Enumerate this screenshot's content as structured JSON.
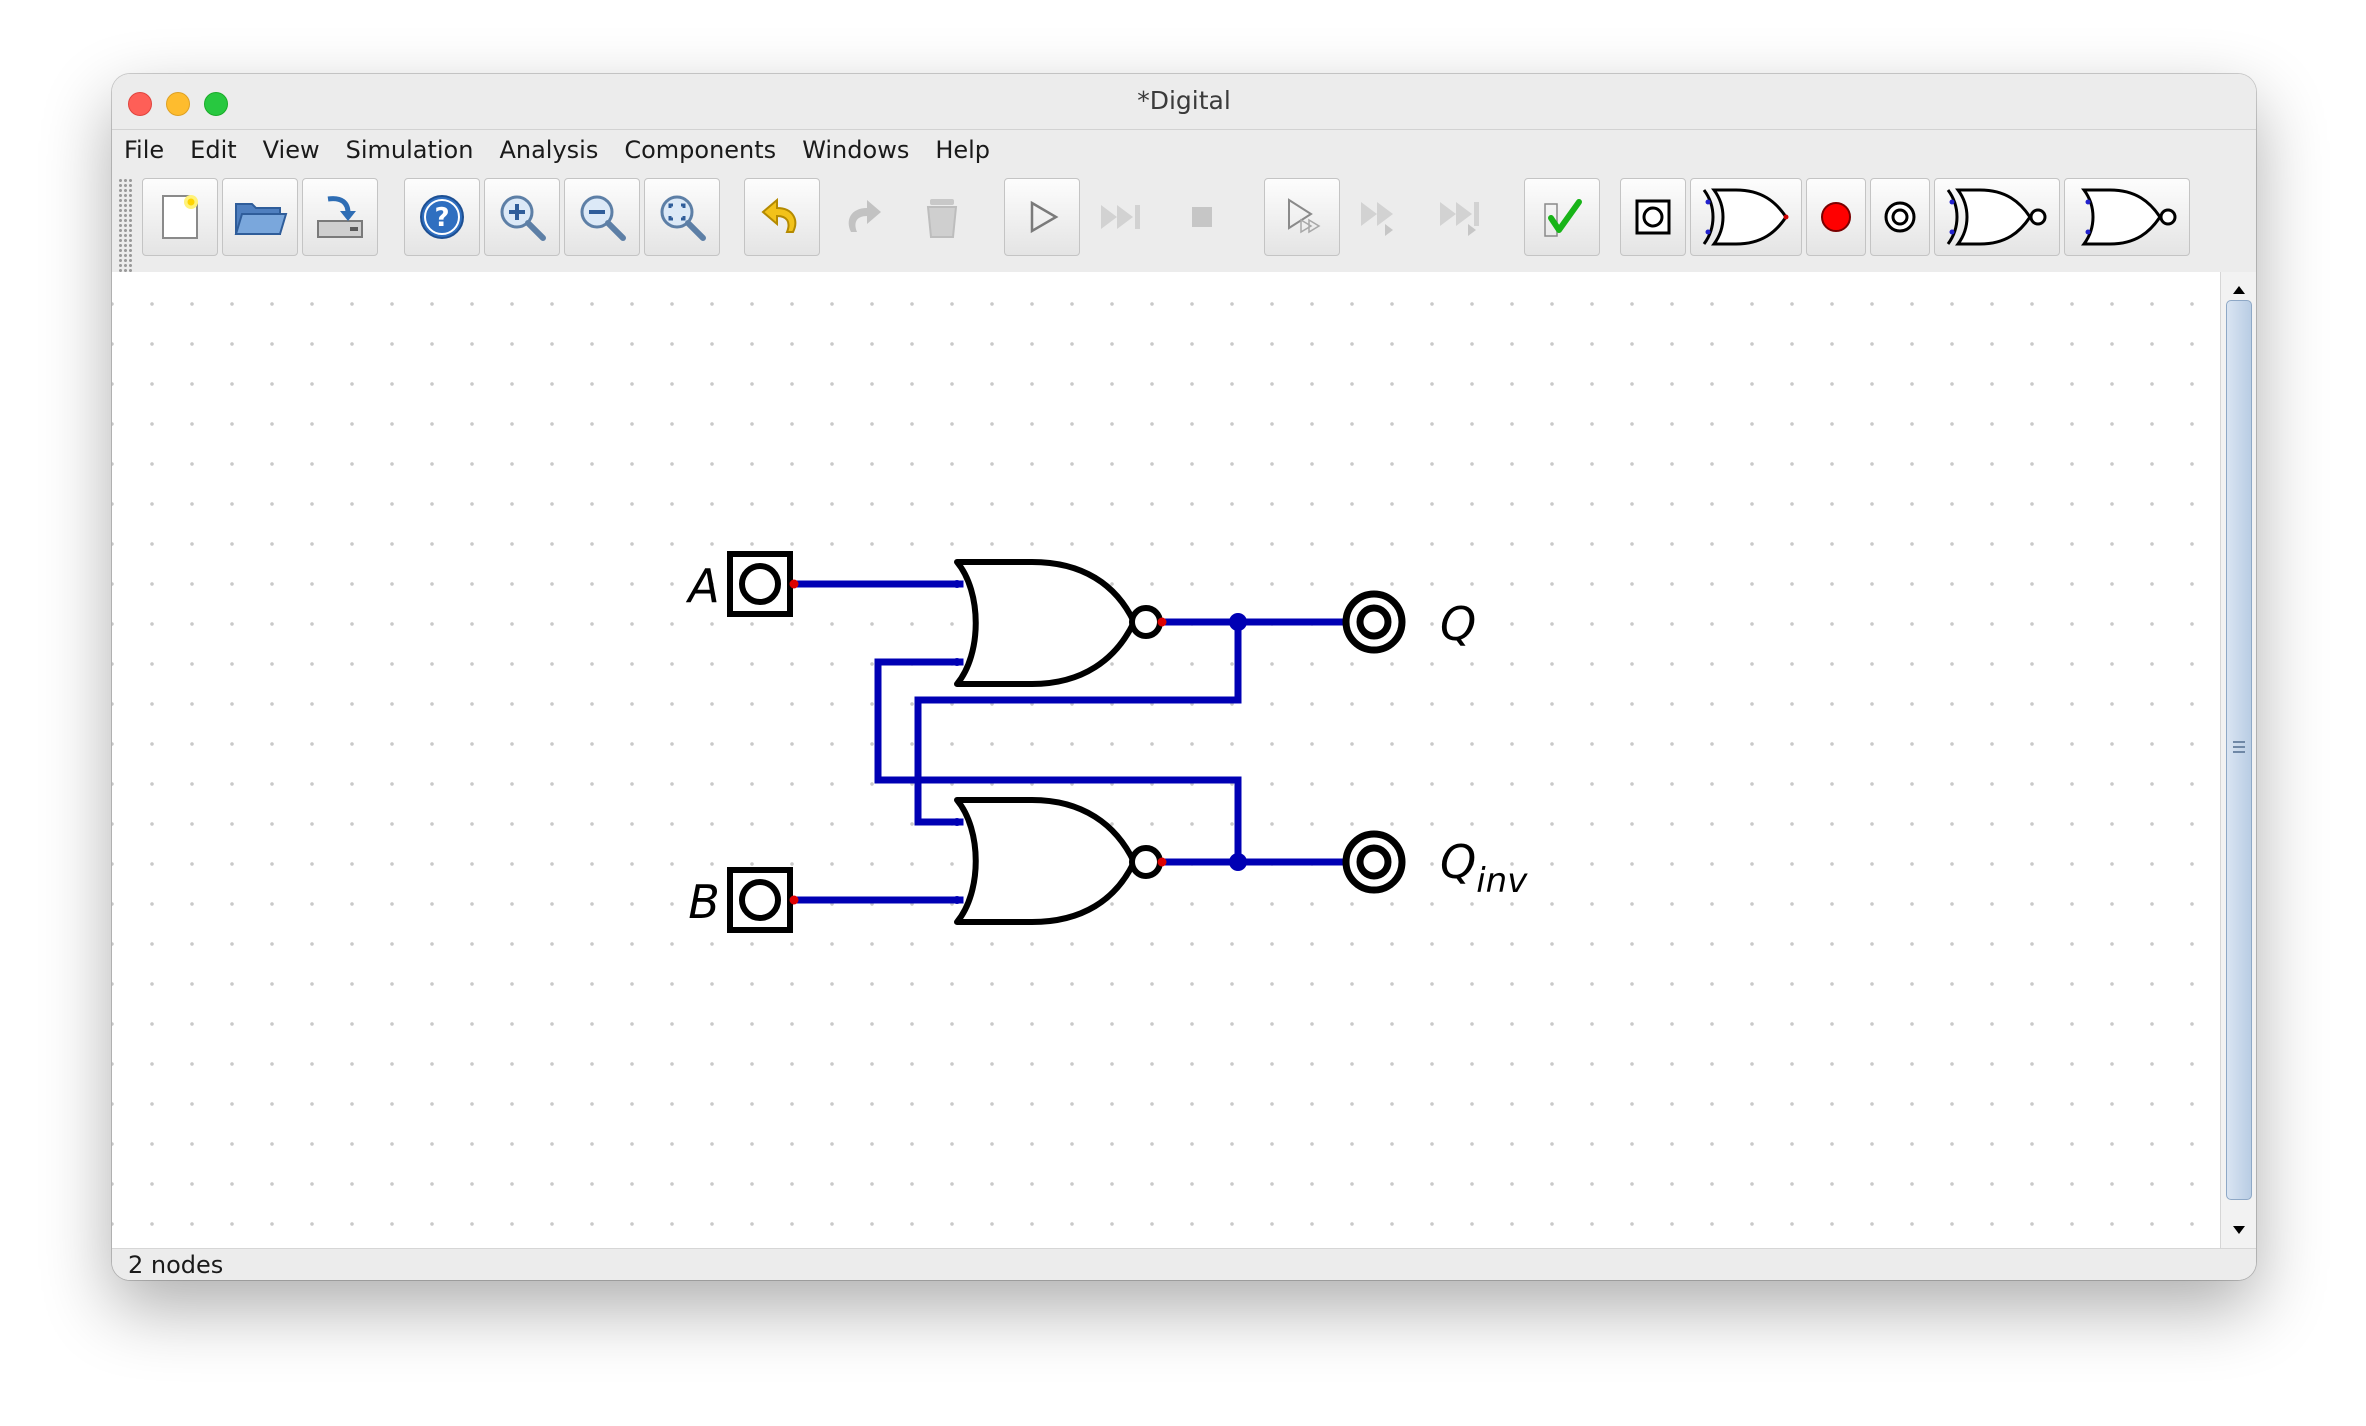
{
  "window": {
    "title": "*Digital"
  },
  "menu": {
    "items": [
      "File",
      "Edit",
      "View",
      "Simulation",
      "Analysis",
      "Components",
      "Windows",
      "Help"
    ]
  },
  "toolbar": {
    "buttons": [
      {
        "icon": "new-file-icon",
        "enabled": true
      },
      {
        "icon": "open-folder-icon",
        "enabled": true
      },
      {
        "icon": "save-icon",
        "enabled": true
      },
      {
        "icon": "help-icon",
        "enabled": true
      },
      {
        "icon": "zoom-in-icon",
        "enabled": true
      },
      {
        "icon": "zoom-out-icon",
        "enabled": true
      },
      {
        "icon": "zoom-fit-icon",
        "enabled": true
      },
      {
        "icon": "undo-icon",
        "enabled": true
      },
      {
        "icon": "redo-icon",
        "enabled": false
      },
      {
        "icon": "delete-icon",
        "enabled": false
      },
      {
        "icon": "play-icon",
        "enabled": true
      },
      {
        "icon": "fast-forward-icon",
        "enabled": false
      },
      {
        "icon": "stop-icon",
        "enabled": false
      },
      {
        "icon": "micro-step-icon",
        "enabled": true
      },
      {
        "icon": "step-icon",
        "enabled": false
      },
      {
        "icon": "run-to-break-icon",
        "enabled": false
      },
      {
        "icon": "test-check-icon",
        "enabled": true
      },
      {
        "icon": "input-component-icon",
        "enabled": true
      },
      {
        "icon": "xor-gate-icon",
        "enabled": true
      },
      {
        "icon": "led-icon",
        "enabled": true
      },
      {
        "icon": "output-component-icon",
        "enabled": true
      },
      {
        "icon": "xnor-gate-icon",
        "enabled": true
      },
      {
        "icon": "nor-gate-icon",
        "enabled": true
      }
    ]
  },
  "circuit": {
    "inputs": [
      "A",
      "B"
    ],
    "outputs": {
      "q": "Q",
      "q_inv_base": "Q",
      "q_inv_sub": "inv"
    },
    "gates": [
      "NOR",
      "NOR"
    ],
    "wire_color": "#0000b4"
  },
  "status": {
    "text": "2 nodes"
  }
}
